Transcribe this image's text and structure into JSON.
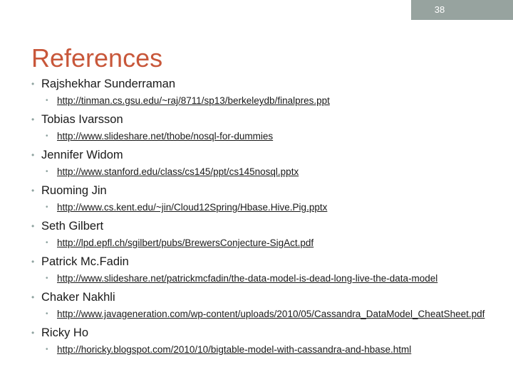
{
  "slide": {
    "number": "38",
    "title": "References",
    "accent_color": "#c8573a",
    "header_color": "#97a39f"
  },
  "references": [
    {
      "name": "Rajshekhar Sunderraman",
      "url": "http://tinman.cs.gsu.edu/~raj/8711/sp13/berkeleydb/finalpres.ppt"
    },
    {
      "name": "Tobias Ivarsson",
      "url": "http://www.slideshare.net/thobe/nosql-for-dummies"
    },
    {
      "name": "Jennifer Widom",
      "url": "http://www.stanford.edu/class/cs145/ppt/cs145nosql.pptx"
    },
    {
      "name": "Ruoming Jin",
      "url": "http://www.cs.kent.edu/~jin/Cloud12Spring/Hbase.Hive.Pig.pptx"
    },
    {
      "name": "Seth Gilbert",
      "url": "http://lpd.epfl.ch/sgilbert/pubs/BrewersConjecture-SigAct.pdf"
    },
    {
      "name": "Patrick Mc.Fadin",
      "url": "http://www.slideshare.net/patrickmcfadin/the-data-model-is-dead-long-live-the-data-model"
    },
    {
      "name": "Chaker Nakhli",
      "url": "http://www.javageneration.com/wp-content/uploads/2010/05/Cassandra_DataModel_CheatSheet.pdf"
    },
    {
      "name": "Ricky Ho",
      "url": "http://horicky.blogspot.com/2010/10/bigtable-model-with-cassandra-and-hbase.html"
    }
  ]
}
